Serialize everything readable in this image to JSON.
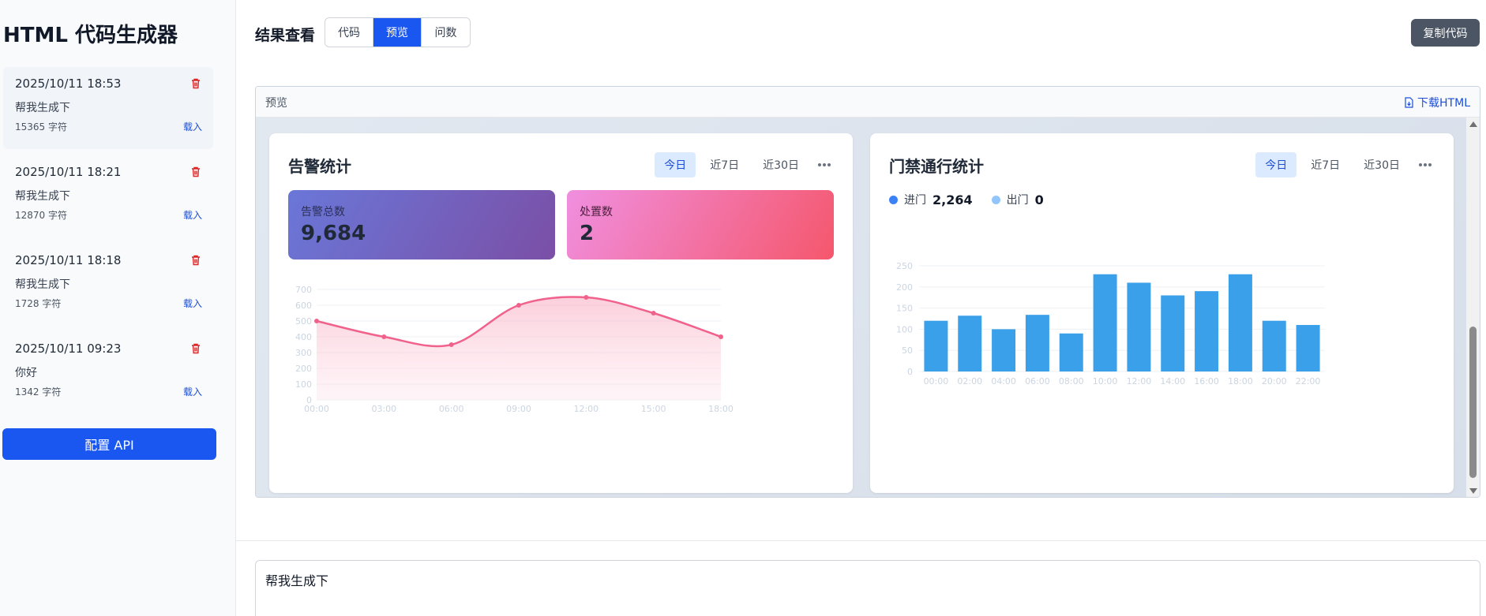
{
  "app": {
    "title": "HTML 代码生成器"
  },
  "history": [
    {
      "date": "2025/10/11 18:53",
      "prompt": "帮我生成下",
      "size": "15365 字符",
      "load_label": "载入"
    },
    {
      "date": "2025/10/11 18:21",
      "prompt": "帮我生成下",
      "size": "12870 字符",
      "load_label": "载入"
    },
    {
      "date": "2025/10/11 18:18",
      "prompt": "帮我生成下",
      "size": "1728 字符",
      "load_label": "载入"
    },
    {
      "date": "2025/10/11 09:23",
      "prompt": "你好",
      "size": "1342 字符",
      "load_label": "载入"
    }
  ],
  "sidebar": {
    "config_api_label": "配置 API"
  },
  "header": {
    "title": "结果查看",
    "tabs": [
      {
        "label": "代码"
      },
      {
        "label": "预览"
      },
      {
        "label": "问数"
      }
    ],
    "active_tab": "预览",
    "copy_label": "复制代码"
  },
  "preview": {
    "label": "预览",
    "download_label": "下载HTML"
  },
  "alarm_card": {
    "title": "告警统计",
    "periods": [
      "今日",
      "近7日",
      "近30日"
    ],
    "active_period": "今日",
    "total_label": "告警总数",
    "total_value": "9,684",
    "handled_label": "处置数",
    "handled_value": "2"
  },
  "access_card": {
    "title": "门禁通行统计",
    "periods": [
      "今日",
      "近7日",
      "近30日"
    ],
    "active_period": "今日",
    "in_label": "进门",
    "in_value": "2,264",
    "out_label": "出门",
    "out_value": "0"
  },
  "colors": {
    "primary": "#1a56f0",
    "alarm_line": "#f0628c",
    "bar": "#3aa0ea",
    "in_dot": "#3b82f6",
    "out_dot": "#93c5fd",
    "delete": "#dc2626"
  },
  "chart_data": [
    {
      "type": "area",
      "title": "",
      "x": [
        "00:00",
        "03:00",
        "06:00",
        "09:00",
        "12:00",
        "15:00",
        "18:00"
      ],
      "series": [
        {
          "values": [
            500,
            400,
            350,
            600,
            650,
            550,
            400
          ]
        }
      ],
      "ylim": [
        0,
        700
      ],
      "yticks": [
        0,
        100,
        200,
        300,
        400,
        500,
        600,
        700
      ],
      "grid": true
    },
    {
      "type": "bar",
      "title": "",
      "categories": [
        "00:00",
        "02:00",
        "04:00",
        "06:00",
        "08:00",
        "10:00",
        "12:00",
        "14:00",
        "16:00",
        "18:00",
        "20:00",
        "22:00"
      ],
      "values": [
        120,
        132,
        100,
        134,
        90,
        230,
        210,
        180,
        190,
        230,
        120,
        110
      ],
      "ylim": [
        0,
        250
      ],
      "yticks": [
        0,
        50,
        100,
        150,
        200,
        250
      ],
      "grid": true
    }
  ],
  "prompt": {
    "text": "帮我生成下"
  }
}
